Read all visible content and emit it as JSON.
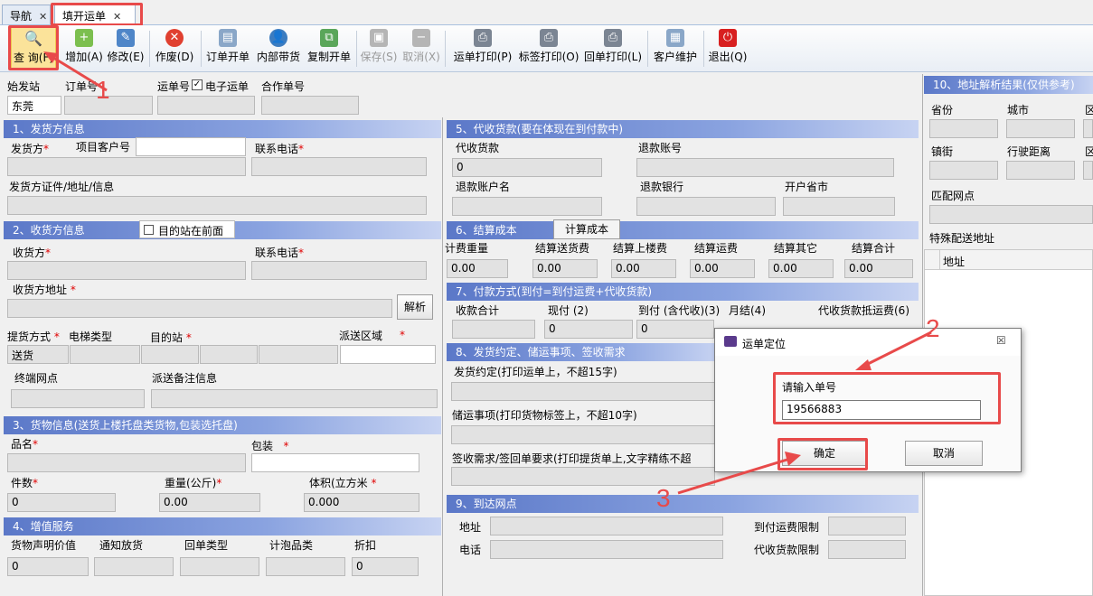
{
  "tabs": [
    {
      "label": "导航"
    },
    {
      "label": "填开运单"
    }
  ],
  "toolbar": {
    "query": "查 询(F)",
    "add": "增加(A)",
    "edit": "修改(E)",
    "void": "作废(D)",
    "order_open": "订单开单",
    "internal": "内部带货",
    "copy": "复制开单",
    "save": "保存(S)",
    "cancel": "取消(X)",
    "print_waybill": "运单打印(P)",
    "print_label": "标签打印(O)",
    "print_return": "回单打印(L)",
    "customer": "客户维护",
    "exit": "退出(Q)"
  },
  "header": {
    "origin_label": "始发站",
    "origin_value": "东莞",
    "order_label": "订单号",
    "waybill_label": "运单号",
    "eorder_label": "电子运单",
    "contract_label": "合作单号"
  },
  "s1": {
    "title": "1、发货方信息",
    "shipper": "发货方",
    "project_customer": "项目客户号",
    "phone": "联系电话",
    "cert": "发货方证件/地址/信息"
  },
  "s2": {
    "title": "2、收货方信息",
    "dest_first": "目的站在前面",
    "receiver": "收货方",
    "phone": "联系电话",
    "address": "收货方地址",
    "parse": "解析",
    "pickup": "提货方式",
    "elevator": "电梯类型",
    "dest": "目的站",
    "zone": "派送区域",
    "pickup_value": "送货",
    "terminal": "终端网点",
    "remark": "派送备注信息"
  },
  "s3": {
    "title": "3、货物信息(送货上楼托盘类货物,包装选托盘)",
    "name": "品名",
    "pack": "包装",
    "count": "件数",
    "count_v": "0",
    "weight": "重量(公斤)",
    "weight_v": "0.00",
    "volume": "体积(立方米",
    "volume_v": "0.000"
  },
  "s4": {
    "title": "4、增值服务",
    "declared": "货物声明价值",
    "notify": "通知放货",
    "return_type": "回单类型",
    "foam": "计泡品类",
    "discount": "折扣",
    "declared_v": "0",
    "discount_v": "0"
  },
  "s5": {
    "title": "5、代收货款(要在体现在到付款中)",
    "cod": "代收货款",
    "cod_v": "0",
    "refund_acct": "退款账号",
    "refund_name": "退款账户名",
    "refund_bank": "退款银行",
    "province": "开户省市"
  },
  "s6": {
    "title": "6、结算成本",
    "calc_btn": "计算成本",
    "fee_weight": "计费重量",
    "delivery": "结算送货费",
    "upstairs": "结算上楼费",
    "freight": "结算运费",
    "other": "结算其它",
    "total": "结算合计",
    "zero": "0.00"
  },
  "s7": {
    "title": "7、付款方式(到付=到付运费+代收货款)",
    "total": "收款合计",
    "cash": "现付 (2)",
    "arrival": "到付 (含代收)(3)",
    "monthly": "月结(4)",
    "cod_offset": "代收货款抵运费(6)",
    "zero": "0"
  },
  "s8": {
    "title": "8、发货约定、储运事项、签收需求",
    "agree": "发货约定(打印运单上，不超15字)",
    "storage": "储运事项(打印货物标签上，不超10字)",
    "sign": "签收需求/签回单要求(打印提货单上,文字精练不超"
  },
  "s9": {
    "title": "9、到达网点",
    "address": "地址",
    "phone": "电话",
    "limit_arrival": "到付运费限制",
    "limit_cod": "代收货款限制"
  },
  "s10": {
    "title": "10、地址解析结果(仅供参考)",
    "province": "省份",
    "city": "城市",
    "town": "镇街",
    "distance": "行驶距离",
    "match": "匹配网点",
    "special": "特殊配送地址",
    "addr_col": "地址"
  },
  "dialog": {
    "title": "运单定位",
    "prompt": "请输入单号",
    "value": "19566883",
    "ok": "确定",
    "cancel": "取消"
  },
  "annotations": {
    "n1": "1",
    "n2": "2",
    "n3": "3"
  }
}
